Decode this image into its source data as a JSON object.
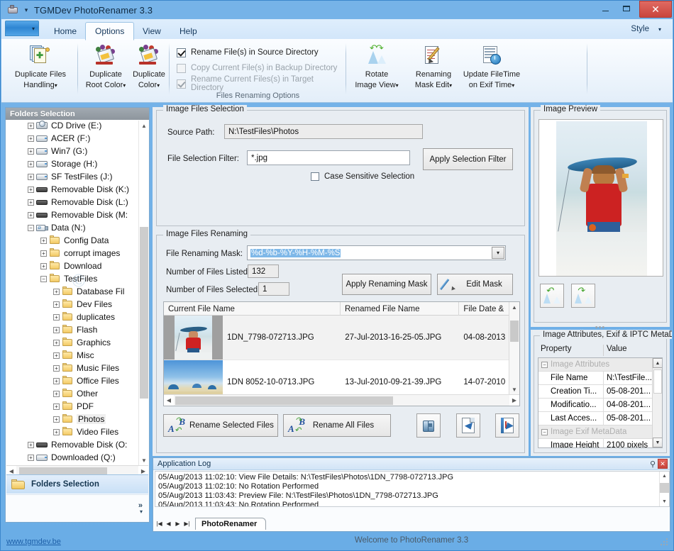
{
  "window": {
    "title": "TGMDev PhotoRenamer 3.3",
    "app_icon": "camera-icon",
    "minimize": "–",
    "maximize": "□",
    "close": "✕"
  },
  "ribbon": {
    "file_tab_caret": "▾",
    "tabs": [
      {
        "label": "Home",
        "active": false
      },
      {
        "label": "Options",
        "active": true
      },
      {
        "label": "View",
        "active": false
      },
      {
        "label": "Help",
        "active": false
      }
    ],
    "style_button": "Style",
    "style_caret": "▾",
    "groups": [
      {
        "caption": "",
        "buttons": [
          {
            "label_line1": "Duplicate Files",
            "label_line2": "Handling",
            "dropdown": "▾",
            "icon": "duplicate-files-icon"
          }
        ]
      },
      {
        "caption": "",
        "buttons": [
          {
            "label_line1": "Duplicate",
            "label_line2": "Root Color",
            "dropdown": "▾",
            "icon": "paint-bucket-icon"
          },
          {
            "label_line1": "Duplicate",
            "label_line2": "Color",
            "dropdown": "▾",
            "icon": "paint-bucket-icon"
          }
        ]
      },
      {
        "caption": "Files Renaming Options",
        "checkboxes": [
          {
            "label": "Rename File(s) in Source Directory",
            "checked": true,
            "enabled": true
          },
          {
            "label": "Copy Current File(s) in Backup Directory",
            "checked": false,
            "enabled": false
          },
          {
            "label": "Rename Current Files(s) in Target Directory",
            "checked": true,
            "enabled": false
          }
        ]
      },
      {
        "caption": "",
        "buttons": [
          {
            "label_line1": "Rotate",
            "label_line2": "Image View",
            "dropdown": "▾",
            "icon": "rotate-image-icon"
          },
          {
            "label_line1": "Renaming",
            "label_line2": "Mask Edit",
            "dropdown": "▾",
            "icon": "mask-edit-icon"
          },
          {
            "label_line1": "Update FileTime",
            "label_line2": "on Exif Time",
            "dropdown": "▾",
            "icon": "filetime-clock-icon"
          }
        ]
      }
    ]
  },
  "folders_panel": {
    "header": "Folders Selection",
    "footer_label": "Folders Selection",
    "footer_icon": "folder-icon",
    "overflow_chevron": "»",
    "overflow_caret": "▾",
    "tree": [
      {
        "label": "CD Drive (E:)",
        "indent": 1,
        "expander": "+",
        "icon": "cd-drive-icon",
        "selected": false
      },
      {
        "label": "ACER (F:)",
        "indent": 1,
        "expander": "+",
        "icon": "drive-icon",
        "selected": false
      },
      {
        "label": "Win7 (G:)",
        "indent": 1,
        "expander": "+",
        "icon": "drive-icon",
        "selected": false
      },
      {
        "label": "Storage (H:)",
        "indent": 1,
        "expander": "+",
        "icon": "drive-icon",
        "selected": false
      },
      {
        "label": "SF TestFiles (J:)",
        "indent": 1,
        "expander": "+",
        "icon": "drive-icon",
        "selected": false
      },
      {
        "label": "Removable Disk (K:)",
        "indent": 1,
        "expander": "+",
        "icon": "usb-drive-icon",
        "selected": false
      },
      {
        "label": "Removable Disk (L:)",
        "indent": 1,
        "expander": "+",
        "icon": "usb-drive-icon",
        "selected": false
      },
      {
        "label": "Removable Disk (M:",
        "indent": 1,
        "expander": "+",
        "icon": "usb-drive-icon",
        "selected": false
      },
      {
        "label": "Data (N:)",
        "indent": 1,
        "expander": "−",
        "icon": "network-drive-icon",
        "selected": false
      },
      {
        "label": "Config Data",
        "indent": 2,
        "expander": "+",
        "icon": "folder-icon",
        "selected": false
      },
      {
        "label": "corrupt images",
        "indent": 2,
        "expander": "+",
        "icon": "folder-icon",
        "selected": false
      },
      {
        "label": "Download",
        "indent": 2,
        "expander": "+",
        "icon": "folder-icon",
        "selected": false
      },
      {
        "label": "TestFiles",
        "indent": 2,
        "expander": "−",
        "icon": "folder-icon",
        "selected": false
      },
      {
        "label": "Database Fil",
        "indent": 3,
        "expander": "+",
        "icon": "folder-icon",
        "selected": false
      },
      {
        "label": "Dev Files",
        "indent": 3,
        "expander": "+",
        "icon": "folder-icon",
        "selected": false
      },
      {
        "label": "duplicates",
        "indent": 3,
        "expander": "+",
        "icon": "folder-icon",
        "selected": false
      },
      {
        "label": "Flash",
        "indent": 3,
        "expander": "+",
        "icon": "folder-icon",
        "selected": false
      },
      {
        "label": "Graphics",
        "indent": 3,
        "expander": "+",
        "icon": "folder-icon",
        "selected": false
      },
      {
        "label": "Misc",
        "indent": 3,
        "expander": "+",
        "icon": "folder-icon",
        "selected": false
      },
      {
        "label": "Music Files",
        "indent": 3,
        "expander": "+",
        "icon": "folder-icon",
        "selected": false
      },
      {
        "label": "Office Files",
        "indent": 3,
        "expander": "+",
        "icon": "folder-icon",
        "selected": false
      },
      {
        "label": "Other",
        "indent": 3,
        "expander": "+",
        "icon": "folder-icon",
        "selected": false
      },
      {
        "label": "PDF",
        "indent": 3,
        "expander": "+",
        "icon": "folder-icon",
        "selected": false
      },
      {
        "label": "Photos",
        "indent": 3,
        "expander": "+",
        "icon": "folder-icon",
        "selected": true
      },
      {
        "label": "Video Files",
        "indent": 3,
        "expander": "+",
        "icon": "folder-icon",
        "selected": false
      },
      {
        "label": "Removable Disk (O:",
        "indent": 1,
        "expander": "+",
        "icon": "usb-drive-icon",
        "selected": false
      },
      {
        "label": "Downloaded (Q:)",
        "indent": 1,
        "expander": "+",
        "icon": "drive-icon",
        "selected": false
      }
    ]
  },
  "selection_group": {
    "title": "Image Files Selection",
    "source_path_label": "Source Path:",
    "source_path_value": "N:\\TestFiles\\Photos",
    "filter_label": "File Selection Filter:",
    "filter_value": "*.jpg",
    "filter_placeholder": "*.jpg",
    "case_sensitive_label": "Case Sensitive Selection",
    "case_sensitive_checked": false,
    "apply_filter_button": "Apply Selection Filter"
  },
  "renaming_group": {
    "title": "Image Files Renaming",
    "mask_label": "File Renaming Mask:",
    "mask_value": "%d-%b-%Y-%H-%M-%S",
    "mask_caret": "▾",
    "files_listed_label": "Number of Files Listed:",
    "files_listed_value": "132",
    "files_selected_label": "Number of Files Selected:",
    "files_selected_value": "1",
    "apply_mask_button": "Apply Renaming Mask",
    "edit_mask_button": "Edit Mask",
    "edit_mask_icon": "pen-icon"
  },
  "file_list": {
    "columns": [
      "Current File Name",
      "Renamed File Name",
      "File Date & "
    ],
    "rows": [
      {
        "current_name": "1DN_7798-072713.JPG",
        "renamed_name": "27-Jul-2013-16-25-05.JPG",
        "file_date": "04-08-2013",
        "selected": true,
        "thumb": "boy-with-bodyboard"
      },
      {
        "current_name": "1DN  8052-10-0713.JPG",
        "renamed_name": "13-Jul-2010-09-21-39.JPG",
        "file_date": "14-07-2010",
        "selected": false,
        "thumb": "beach-umbrellas"
      }
    ]
  },
  "action_bar": {
    "rename_selected_button": "Rename Selected Files",
    "rename_selected_icon": "ab-rename-icon",
    "rename_all_button": "Rename All Files",
    "rename_all_icon": "ab-rename-icon",
    "find_icon": "binoculars-icon",
    "prev_icon": "page-back-icon",
    "next_icon": "page-forward-icon"
  },
  "preview_group": {
    "title": "Image Preview",
    "image_alt": "boy-with-bodyboard",
    "rotate_left_icon": "rotate-left-icon",
    "rotate_right_icon": "rotate-right-icon",
    "splitter_dots": "•••"
  },
  "attributes_group": {
    "title": "Image Attributes, Exif & IPTC MetaDa",
    "columns": [
      "Property",
      "Value"
    ],
    "rows": [
      {
        "type": "group",
        "property": "Image Attributes",
        "value": "",
        "expander": "−"
      },
      {
        "type": "item",
        "property": "File Name",
        "value": "N:\\TestFile..."
      },
      {
        "type": "item",
        "property": "Creation Ti...",
        "value": "05-08-201..."
      },
      {
        "type": "item",
        "property": "Modificatio...",
        "value": "04-08-201..."
      },
      {
        "type": "item",
        "property": "Last Acces...",
        "value": "05-08-201..."
      },
      {
        "type": "group",
        "property": "Image Exif MetaData",
        "value": "",
        "expander": "−"
      },
      {
        "type": "item",
        "property": "Image Height",
        "value": "2100 pixels"
      }
    ]
  },
  "log_panel": {
    "title": "Application Log",
    "pin_icon": "pin-icon",
    "close_icon": "close-icon",
    "lines": [
      "05/Aug/2013 11:02:10: View File Details: N:\\TestFiles\\Photos\\1DN_7798-072713.JPG",
      "05/Aug/2013 11:02:10: No Rotation Performed",
      "05/Aug/2013 11:03:43: Preview File: N:\\TestFiles\\Photos\\1DN_7798-072713.JPG",
      "05/Aug/2013 11:03:43: No Rotation Performed"
    ],
    "nav": {
      "first": "|◀",
      "prev": "◀",
      "next": "▶",
      "last": "▶|"
    },
    "sheet_tab": "PhotoRenamer"
  },
  "status_bar": {
    "message": "Welcome to PhotoRenamer 3.3",
    "web_link": "www.tgmdev.be"
  },
  "colors": {
    "title_bar": "#6aade6",
    "accent": "#2f86d2",
    "close_red": "#c9453d",
    "panel_bg": "#e8edf2",
    "selection_blue": "#7fb8e8"
  }
}
